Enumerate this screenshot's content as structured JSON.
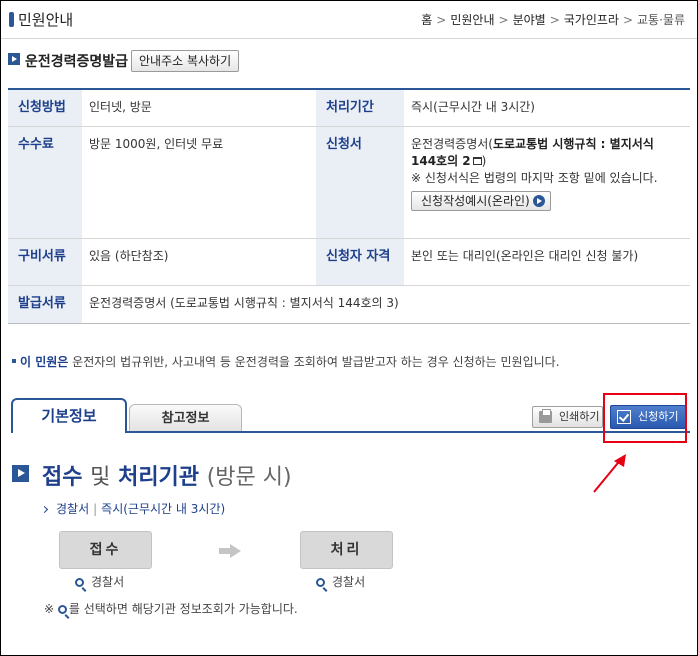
{
  "header": {
    "title": "민원안내",
    "breadcrumbs": [
      "홈",
      "민원안내",
      "분야별",
      "국가인프라",
      "교통·물류"
    ]
  },
  "service": {
    "title": "운전경력증명발급",
    "copy_button": "안내주소 복사하기"
  },
  "info": {
    "method_label": "신청방법",
    "method_value": "인터넷, 방문",
    "period_label": "처리기간",
    "period_value": "즉시(근무시간 내 3시간)",
    "fee_label": "수수료",
    "fee_value": "방문 1000원, 인터넷 무료",
    "form_label": "신청서",
    "form_value_prefix": "운전경력증명서(",
    "form_value_bold": "도로교통법 시행규칙 : 별지서식 144호의 2",
    "form_value_suffix": ")",
    "form_note": "※ 신청서식은 법령의 마지막 조항 밑에 있습니다.",
    "example_button": "신청작성예시(온라인)",
    "docs_label": "구비서류",
    "docs_value": "있음 (하단참조)",
    "qual_label": "신청자 자격",
    "qual_value": "본인 또는 대리인(온라인은 대리인 신청 불가)",
    "issue_label": "발급서류",
    "issue_value": "운전경력증명서 (도로교통법 시행규칙 : 별지서식 144호의 3)"
  },
  "notice": {
    "lead": "이 민원은",
    "text": " 운전자의 법규위반, 사고내역 등 운전경력을 조회하여 발급받고자 하는 경우 신청하는 민원입니다."
  },
  "tabs": {
    "active": "기본정보",
    "other": "참고정보",
    "print_button": "인쇄하기",
    "apply_button": "신청하기"
  },
  "process": {
    "title_bold1": "접수",
    "title_light": "및",
    "title_bold2": "처리기관",
    "title_paren": "(방문 시)",
    "sub_org": "경찰서",
    "sub_time": "즉시(근무시간 내 3시간)",
    "step1": "접수",
    "step2": "처리",
    "step1_org": "경찰서",
    "step2_org": "경찰서",
    "footnote": "※ 를 선택하면 해당기관 정보조회가 가능합니다."
  },
  "colors": {
    "brand_blue": "#2b5797",
    "label_bg": "#eaeef5",
    "highlight_red": "#e60012"
  }
}
